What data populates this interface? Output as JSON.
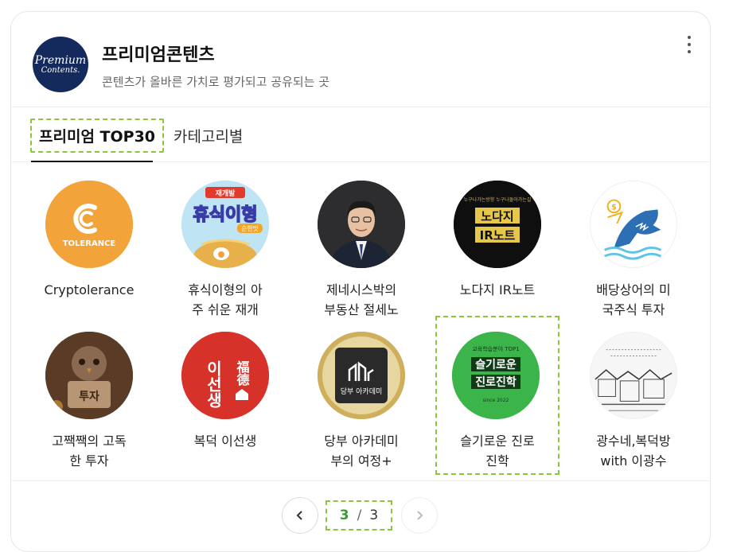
{
  "header": {
    "logo_line1": "Premium",
    "logo_line2": "Contents.",
    "title": "프리미엄콘텐츠",
    "subtitle": "콘텐츠가 올바른 가치로 평가되고 공유되는 곳"
  },
  "tabs": [
    {
      "label": "프리미엄 TOP30",
      "active": true
    },
    {
      "label": "카테고리별",
      "active": false
    }
  ],
  "items": [
    {
      "name": "Cryptolerance",
      "thumb_text": "TOLERANCE",
      "color": "#f2a33a"
    },
    {
      "name": "휴식이형의 아\n주 쉬운 재개",
      "thumb_text": "휴식이형",
      "thumb_badge": "재개발",
      "thumb_sub": "순한맛",
      "color": "#4a56b8"
    },
    {
      "name": "제네시스박의\n부동산 절세노",
      "color": "#2b2b2b"
    },
    {
      "name": "노다지 IR노트",
      "thumb_text": "노다지",
      "thumb_text2": "IR노트",
      "thumb_top": "누구나가는방향 누구나돌아가는길",
      "color": "#111111"
    },
    {
      "name": "배당상어의 미\n국주식 투자",
      "color": "#ffffff"
    },
    {
      "name": "고짹짹의 고독\n한 투자",
      "thumb_text": "투자",
      "color": "#6b4a32"
    },
    {
      "name": "복덕 이선생",
      "thumb_text": "이선생",
      "thumb_text2": "福德",
      "color": "#d9312b"
    },
    {
      "name": "당부 아카데미\n부의 여정+",
      "thumb_text": "당부 아카데미",
      "color": "#2a2a2a"
    },
    {
      "name": "슬기로운 진로\n진학",
      "thumb_text": "슬기로운",
      "thumb_text2": "진로진학",
      "thumb_top": "교육학습분야 TOP1",
      "thumb_sub": "since 2022",
      "color": "#3bb54a",
      "selected": true
    },
    {
      "name": "광수네,복덕방\nwith 이광수",
      "color": "#f4f4f4"
    }
  ],
  "pager": {
    "current": "3",
    "separator": "/",
    "total": "3"
  }
}
